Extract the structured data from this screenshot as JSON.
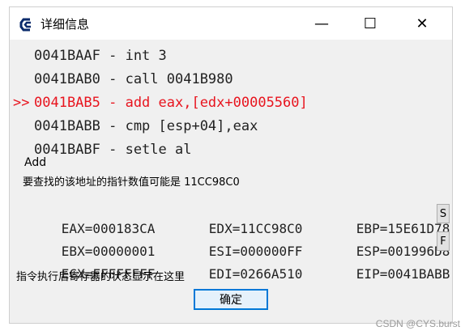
{
  "window": {
    "title": "详细信息",
    "minimize_glyph": "—",
    "maximize_glyph": "☐",
    "close_glyph": "✕",
    "app_icon": "ce-logo-icon"
  },
  "code_lines": [
    {
      "marker": "",
      "text": "0041BAAF - int 3",
      "active": false
    },
    {
      "marker": "",
      "text": "0041BAB0 - call 0041B980",
      "active": false
    },
    {
      "marker": ">>",
      "text": "0041BAB5 - add eax,[edx+00005560]",
      "active": true
    },
    {
      "marker": "",
      "text": "0041BABB - cmp [esp+04],eax",
      "active": false
    },
    {
      "marker": "",
      "text": "0041BABF - setle al",
      "active": false
    }
  ],
  "add_label": "Add",
  "pointer_hint": "要查找的该地址的指针数值可能是 11CC98C0",
  "registers": [
    [
      "EAX=000183CA",
      "EDX=11CC98C0",
      "EBP=15E61D78"
    ],
    [
      "EBX=00000001",
      "ESI=000000FF",
      "ESP=001996D8"
    ],
    [
      "ECX=FFFFFFFF",
      "EDI=0266A510",
      "EIP=0041BABB"
    ]
  ],
  "side_buttons": {
    "s": "S",
    "f": "F"
  },
  "status_hint": "指令执行后寄存器的状态显示在这里",
  "ok_button": "确定",
  "watermark": "CSDN @CYS.burst",
  "colors": {
    "active_line": "#e8141e",
    "ok_border": "#0078d7"
  }
}
